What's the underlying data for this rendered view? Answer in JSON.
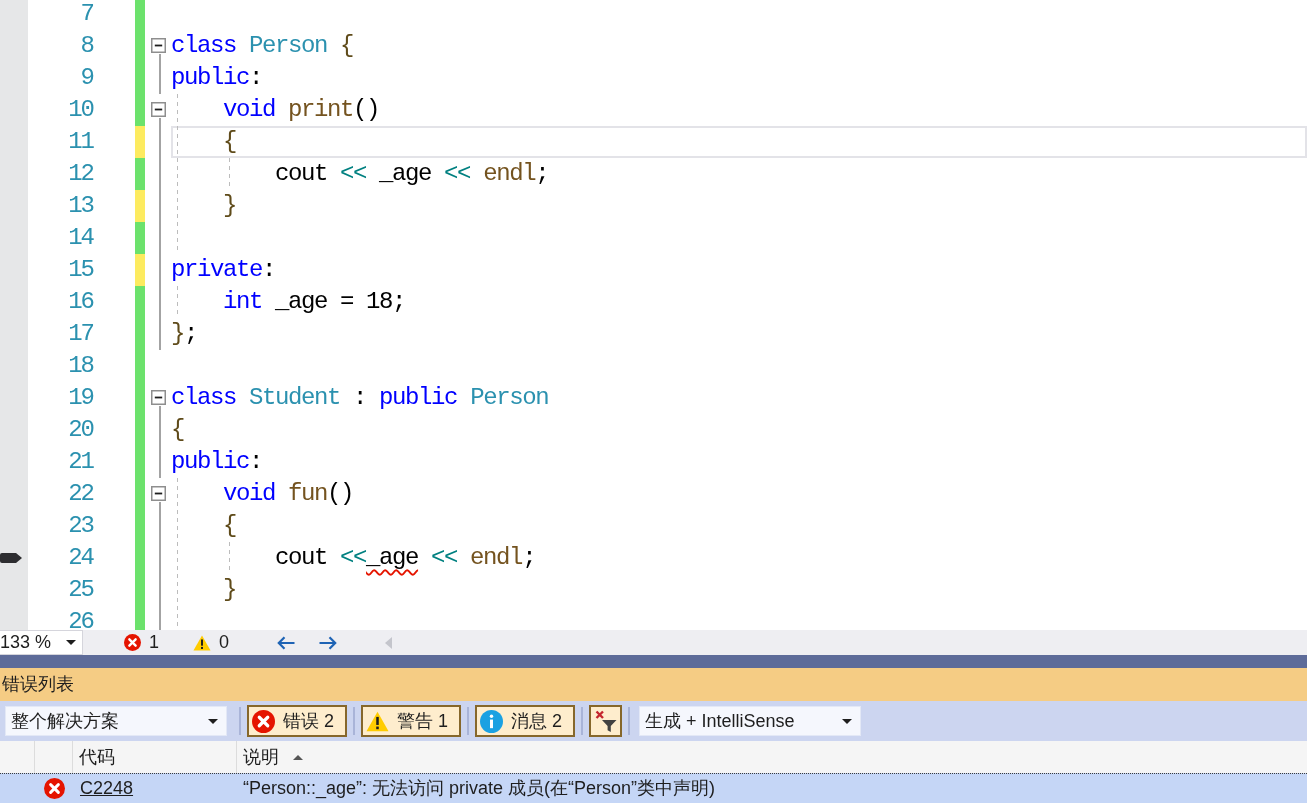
{
  "editor": {
    "lines": [
      {
        "number": "7",
        "saved": true,
        "current": false
      },
      {
        "number": "8",
        "saved": true,
        "current": false,
        "expanded": true,
        "words": [
          [
            {
              "text": "class",
              "kind": "keyword"
            }
          ],
          [
            {
              "text": "Person",
              "kind": "type"
            }
          ],
          [
            {
              "text": "{",
              "kind": "brace"
            }
          ]
        ]
      },
      {
        "number": "9",
        "saved": true,
        "current": false,
        "words": [
          [
            {
              "text": "public",
              "kind": "keyword"
            },
            {
              "text": ":",
              "kind": "plain"
            }
          ]
        ],
        "children": [
          {
            "number": "10",
            "saved": true,
            "current": false,
            "expanded": true,
            "words": [
              [
                {
                  "text": "void",
                  "kind": "keyword"
                }
              ],
              [
                {
                  "text": "print",
                  "kind": "function"
                },
                {
                  "text": "()",
                  "kind": "plain"
                }
              ]
            ]
          },
          {
            "number": "11",
            "saved": false,
            "current": true,
            "words": [
              [
                {
                  "text": "{",
                  "kind": "brace"
                }
              ]
            ],
            "children": [
              {
                "number": "12",
                "saved": true,
                "current": false,
                "words": [
                  [
                    {
                      "text": "cout",
                      "kind": "plain"
                    }
                  ],
                  [
                    {
                      "text": "<<",
                      "kind": "operator"
                    }
                  ],
                  [
                    {
                      "text": "_age",
                      "kind": "plain"
                    }
                  ],
                  [
                    {
                      "text": "<<",
                      "kind": "operator"
                    }
                  ],
                  [
                    {
                      "text": "endl",
                      "kind": "function"
                    },
                    {
                      "text": ";",
                      "kind": "plain"
                    }
                  ]
                ]
              }
            ]
          },
          {
            "number": "13",
            "saved": false,
            "current": false,
            "words": [
              [
                {
                  "text": "}",
                  "kind": "brace"
                }
              ]
            ]
          },
          {
            "number": "14",
            "saved": true,
            "current": false
          }
        ]
      },
      {
        "number": "15",
        "saved": false,
        "current": false,
        "words": [
          [
            {
              "text": "private",
              "kind": "keyword"
            },
            {
              "text": ":",
              "kind": "plain"
            }
          ]
        ],
        "children": [
          {
            "number": "16",
            "saved": true,
            "current": false,
            "words": [
              [
                {
                  "text": "int",
                  "kind": "keyword"
                }
              ],
              [
                {
                  "text": "_age",
                  "kind": "plain"
                }
              ],
              [
                {
                  "text": "=",
                  "kind": "plain"
                }
              ],
              [
                {
                  "text": "18",
                  "kind": "number"
                },
                {
                  "text": ";",
                  "kind": "plain"
                }
              ]
            ]
          }
        ]
      },
      {
        "number": "17",
        "saved": true,
        "current": false,
        "words": [
          [
            {
              "text": "}",
              "kind": "brace"
            },
            {
              "text": ";",
              "kind": "plain"
            }
          ]
        ]
      },
      {
        "number": "18",
        "saved": true,
        "current": false
      },
      {
        "number": "19",
        "saved": true,
        "current": false,
        "expanded": true,
        "words": [
          [
            {
              "text": "class",
              "kind": "keyword"
            }
          ],
          [
            {
              "text": "Student",
              "kind": "type"
            }
          ],
          [
            {
              "text": ":",
              "kind": "plain"
            }
          ],
          [
            {
              "text": "public",
              "kind": "keyword"
            }
          ],
          [
            {
              "text": "Person",
              "kind": "type"
            }
          ]
        ]
      },
      {
        "number": "20",
        "saved": true,
        "current": false,
        "words": [
          [
            {
              "text": "{",
              "kind": "brace"
            }
          ]
        ]
      },
      {
        "number": "21",
        "saved": true,
        "current": false,
        "words": [
          [
            {
              "text": "public",
              "kind": "keyword"
            },
            {
              "text": ":",
              "kind": "plain"
            }
          ]
        ],
        "children": [
          {
            "number": "22",
            "saved": true,
            "current": false,
            "expanded": true,
            "words": [
              [
                {
                  "text": "void",
                  "kind": "keyword"
                }
              ],
              [
                {
                  "text": "fun",
                  "kind": "function"
                },
                {
                  "text": "()",
                  "kind": "plain"
                }
              ]
            ]
          },
          {
            "number": "23",
            "saved": true,
            "current": false,
            "words": [
              [
                {
                  "text": "{",
                  "kind": "brace"
                }
              ]
            ],
            "children": [
              {
                "number": "24",
                "saved": true,
                "current": false,
                "pointer": true,
                "words": [
                  [
                    {
                      "text": "cout",
                      "kind": "plain"
                    }
                  ],
                  [
                    {
                      "text": "<<",
                      "kind": "operator"
                    },
                    {
                      "text": "_age",
                      "kind": "error"
                    }
                  ],
                  [
                    {
                      "text": "<<",
                      "kind": "operator"
                    }
                  ],
                  [
                    {
                      "text": "endl",
                      "kind": "function"
                    },
                    {
                      "text": ";",
                      "kind": "plain"
                    }
                  ]
                ]
              }
            ]
          },
          {
            "number": "25",
            "saved": true,
            "current": false,
            "words": [
              [
                {
                  "text": "}",
                  "kind": "brace"
                }
              ]
            ]
          },
          {
            "number": "26",
            "saved": true,
            "current": false
          }
        ]
      }
    ]
  },
  "status_bar": {
    "zoom": "133 %",
    "error_count": "1",
    "warning_count": "0"
  },
  "error_list": {
    "title": "错误列表",
    "scope": "整个解决方案",
    "filters": [
      {
        "kind": "error",
        "label": "错误 2",
        "on": true
      },
      {
        "kind": "warning",
        "label": "警告 1",
        "on": true
      },
      {
        "kind": "message",
        "label": "消息 2",
        "on": true
      }
    ],
    "source": "生成 + IntelliSense",
    "columns": [
      {
        "label": "代码",
        "sorted": false
      },
      {
        "label": "说明",
        "sorted": true
      }
    ],
    "rows": [
      {
        "kind": "error",
        "code": "C2248",
        "description": "“Person::_age”: 无法访问 private 成员(在“Person”类中声明)",
        "selected": true
      }
    ]
  }
}
